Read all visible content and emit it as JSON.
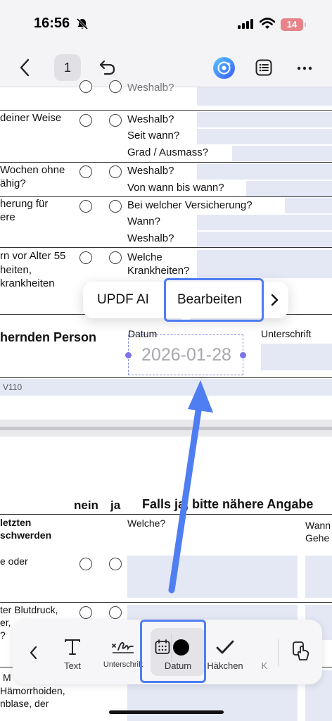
{
  "status_bar": {
    "time": "16:56",
    "battery": "14"
  },
  "toolbar": {
    "page_number": "1"
  },
  "form": {
    "row0": {
      "label_partial": "Weshalb?"
    },
    "row1": {
      "label": "deiner Weise",
      "q1": "Weshalb?",
      "q2": "Seit wann?",
      "q3": "Grad / Ausmass?"
    },
    "row2": {
      "label_line1": " Wochen ohne",
      "label_line2": "ähig?",
      "q1": "Weshalb?",
      "q2": "Von wann bis wann?"
    },
    "row3": {
      "label_line1": "herung für",
      "label_line2": "ere",
      "q1": "Bei welcher Versicherung?",
      "q2": "Wann?",
      "q3": "Weshalb?"
    },
    "row4": {
      "label_line1": "rn vor  Alter 55",
      "label_line2": "heiten,",
      "label_line3": "krankheiten",
      "q1_line1": "Welche",
      "q1_line2": "Krankheiten?"
    },
    "signature_section": {
      "title": "hernden Person",
      "date_label": "Datum",
      "signature_label": "Unterschrift",
      "date_value": "2026-01-28"
    },
    "footer_code": "V110",
    "page2": {
      "header_no": "nein",
      "header_yes": "ja",
      "header_details": "Falls ja, bitte nähere Angabe",
      "row1": {
        "label_line1": "letzten",
        "label_line2": "schwerden",
        "label_line3": "e oder",
        "q1": "Welche?",
        "q2_line1": "Wann",
        "q2_line2": "Gehe"
      },
      "row2": {
        "label_line1": "ter Blutdruck,",
        "label_line2": "er,",
        "label_line3": "?"
      },
      "row3": {
        "label_line1": "M",
        "label_line2": "Hämorrhoiden,",
        "label_line3": "nblase, der"
      }
    }
  },
  "context_menu": {
    "item1": "UPDF AI",
    "item2": "Bearbeiten"
  },
  "bottom_toolbar": {
    "text_label": "Text",
    "signature_label": "Unterschrift",
    "date_label": "Datum",
    "check_label": "Häkchen",
    "cut_label": "K"
  },
  "colors": {
    "highlight": "#4f7df2",
    "field_fill": "#e4e8f5",
    "handle": "#7b74e8"
  }
}
